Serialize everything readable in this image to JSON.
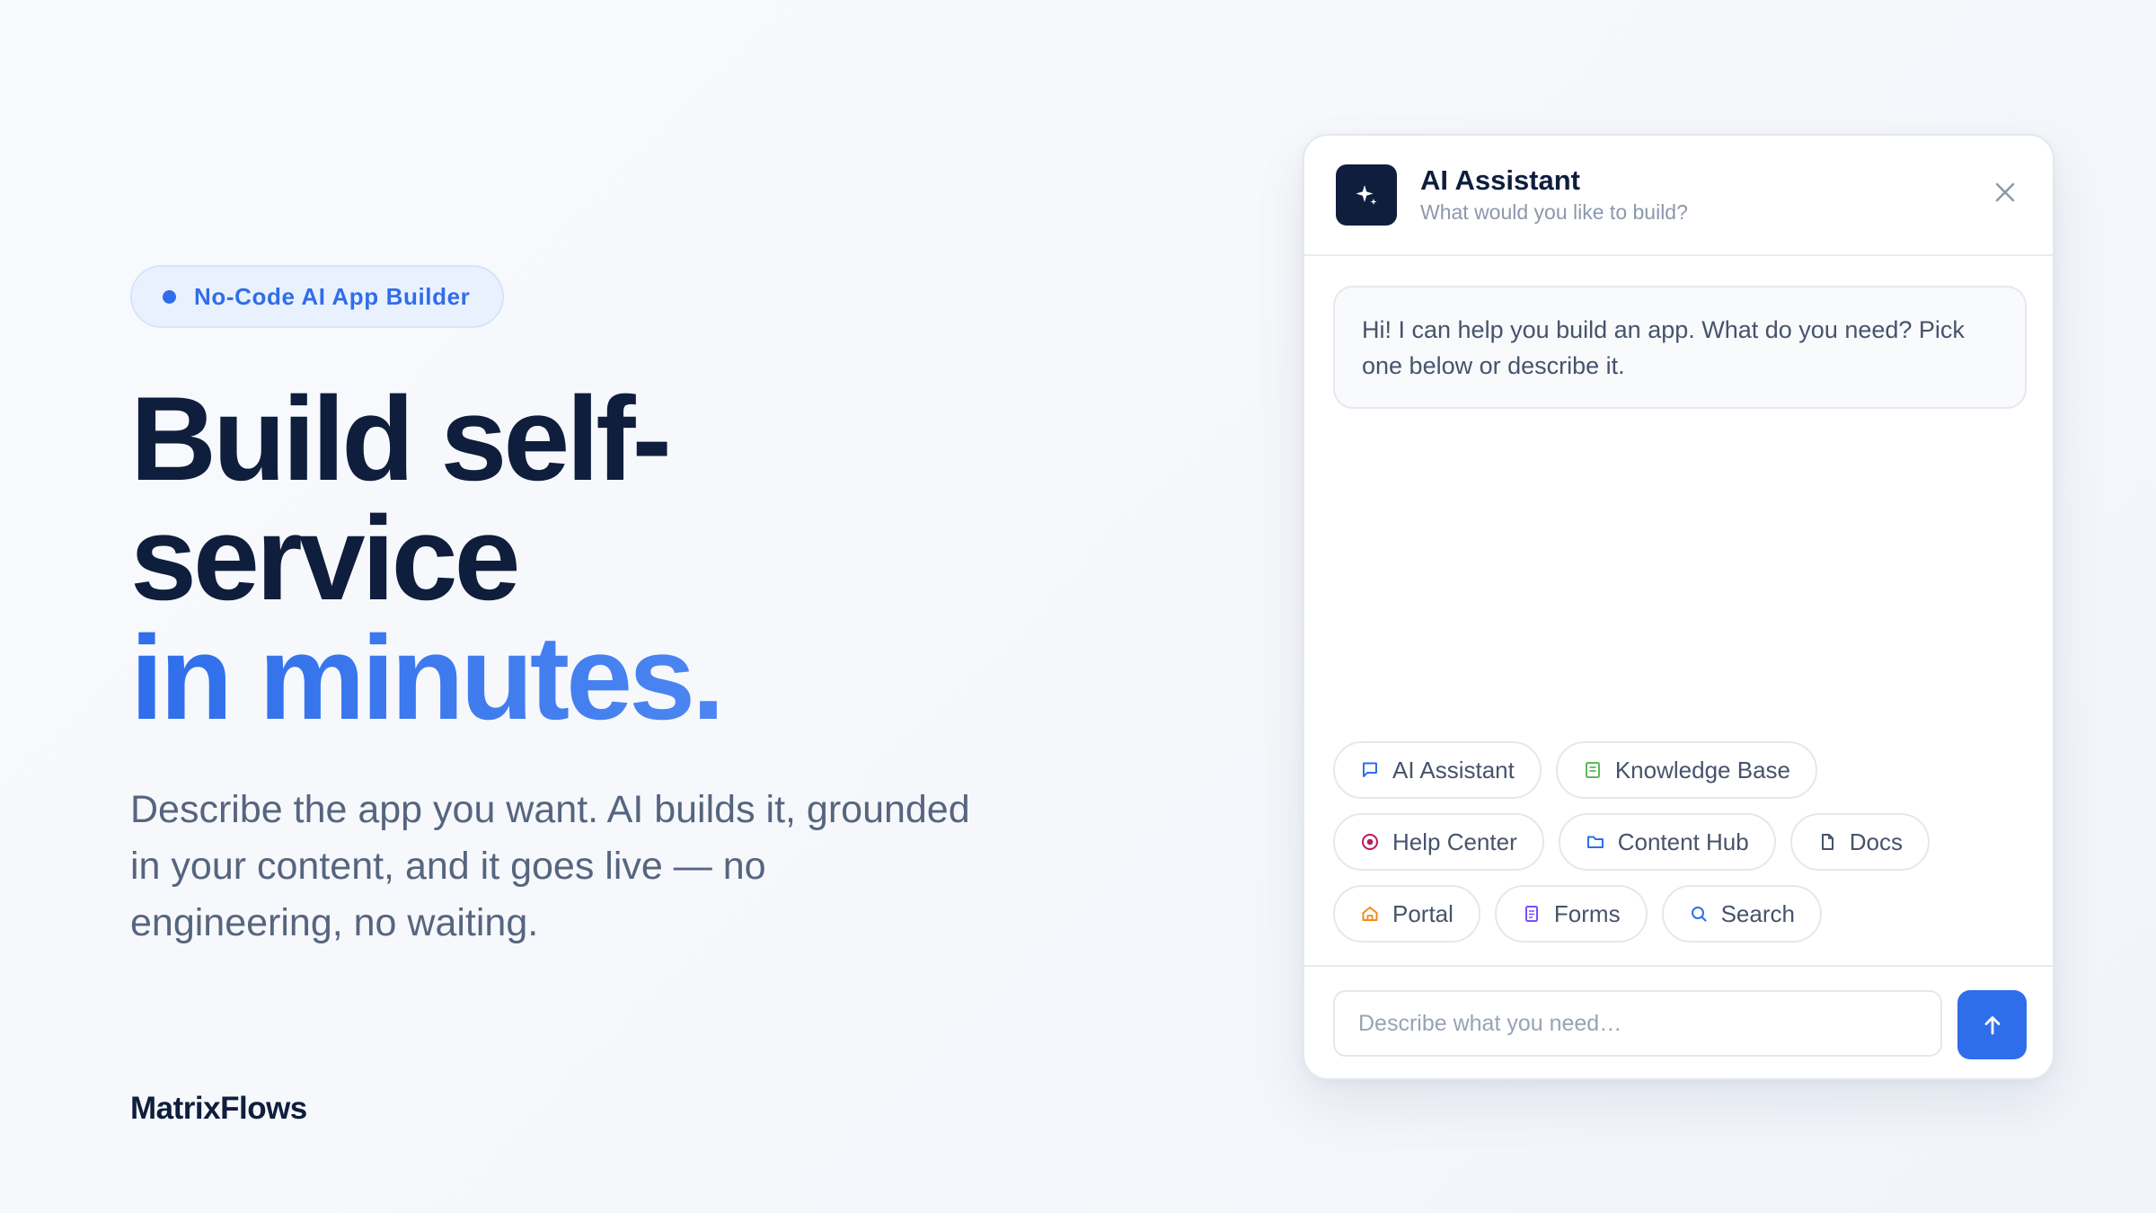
{
  "hero": {
    "badge": "No-Code AI App Builder",
    "headline_line1": "Build self-",
    "headline_line2": "service",
    "headline_accent": "in minutes.",
    "lead": "Describe the app you want. AI builds it, grounded in your content, and it goes live — no engineering, no waiting."
  },
  "brand": "MatrixFlows",
  "assistant": {
    "title": "AI Assistant",
    "subtitle": "What would you like to build?",
    "greeting": "Hi! I can help you build an app. What do you need? Pick one below or describe it.",
    "chips": [
      {
        "label": "AI Assistant",
        "icon": "chat-icon",
        "color": "#2f6eeb"
      },
      {
        "label": "Knowledge Base",
        "icon": "book-icon",
        "color": "#5cb85c"
      },
      {
        "label": "Help Center",
        "icon": "target-icon",
        "color": "#c2185b"
      },
      {
        "label": "Content Hub",
        "icon": "folder-icon",
        "color": "#2f6eeb"
      },
      {
        "label": "Docs",
        "icon": "document-icon",
        "color": "#46536b"
      },
      {
        "label": "Portal",
        "icon": "home-icon",
        "color": "#f08a1c"
      },
      {
        "label": "Forms",
        "icon": "form-icon",
        "color": "#7c4dff"
      },
      {
        "label": "Search",
        "icon": "search-icon",
        "color": "#2f6eeb"
      }
    ],
    "input_placeholder": "Describe what you need…",
    "accent_color": "#2f6eeb"
  }
}
